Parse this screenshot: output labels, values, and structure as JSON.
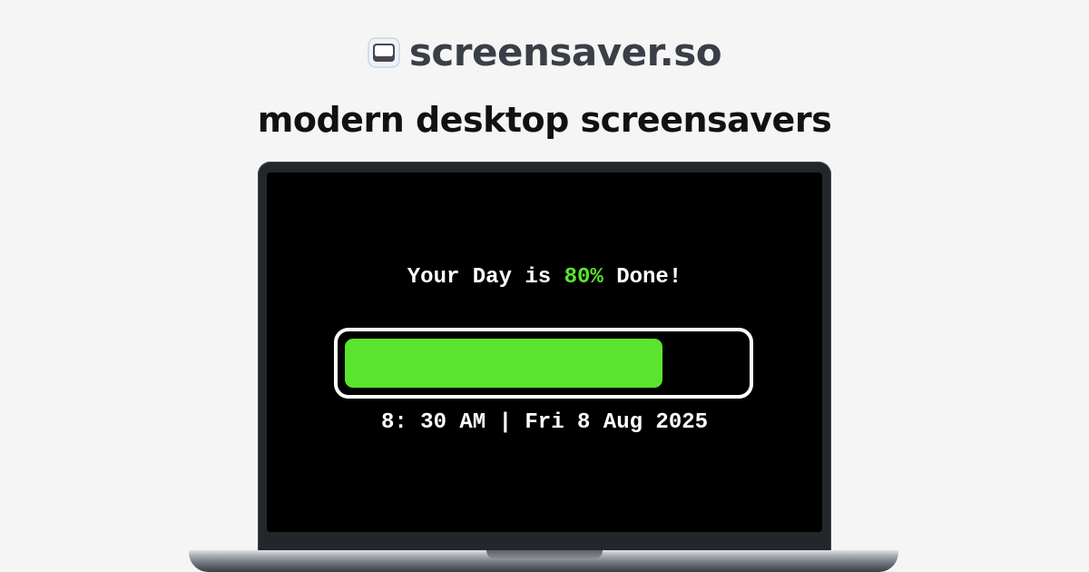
{
  "brand": {
    "name": "screensaver.so",
    "icon": "monitor-icon"
  },
  "tagline": "modern desktop screensavers",
  "screensaver": {
    "headline_prefix": "Your Day is ",
    "percent_text": "80%",
    "headline_suffix": " Done!",
    "progress_fraction": 0.8,
    "clock": "8: 30 AM | Fri 8 Aug 2025"
  },
  "colors": {
    "accent_green": "#5ae42e",
    "page_background": "#f5f5f5",
    "screen_background": "#000000",
    "brand_text": "#3a3f47"
  }
}
